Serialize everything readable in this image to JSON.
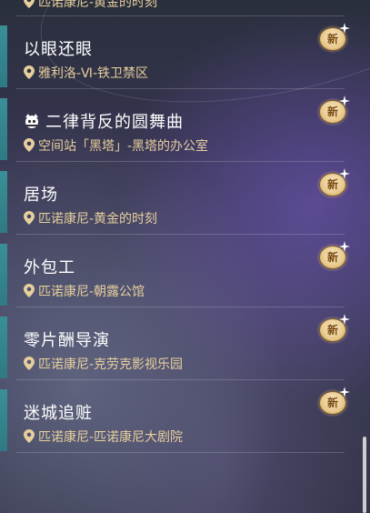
{
  "quests": [
    {
      "title": "",
      "location": "匹诺康尼-黄金的时刻",
      "new_label": "新",
      "truncated": true
    },
    {
      "title": "以眼还眼",
      "location": "雅利洛-Ⅵ-铁卫禁区",
      "new_label": "新"
    },
    {
      "title": "二律背反的圆舞曲",
      "location": "空间站「黑塔」-黑塔的办公室",
      "new_label": "新",
      "icon": "pom-pom-icon"
    },
    {
      "title": "居场",
      "location": "匹诺康尼-黄金的时刻",
      "new_label": "新"
    },
    {
      "title": "外包工",
      "location": "匹诺康尼-朝露公馆",
      "new_label": "新"
    },
    {
      "title": "零片酬导演",
      "location": "匹诺康尼-克劳克影视乐园",
      "new_label": "新"
    },
    {
      "title": "迷城追赃",
      "location": "匹诺康尼-匹诺康尼大剧院",
      "new_label": "新"
    }
  ],
  "colors": {
    "accent_bar": "#3a8f97",
    "location_text": "#e7cf9d",
    "badge_gold": "#e8c98d"
  }
}
